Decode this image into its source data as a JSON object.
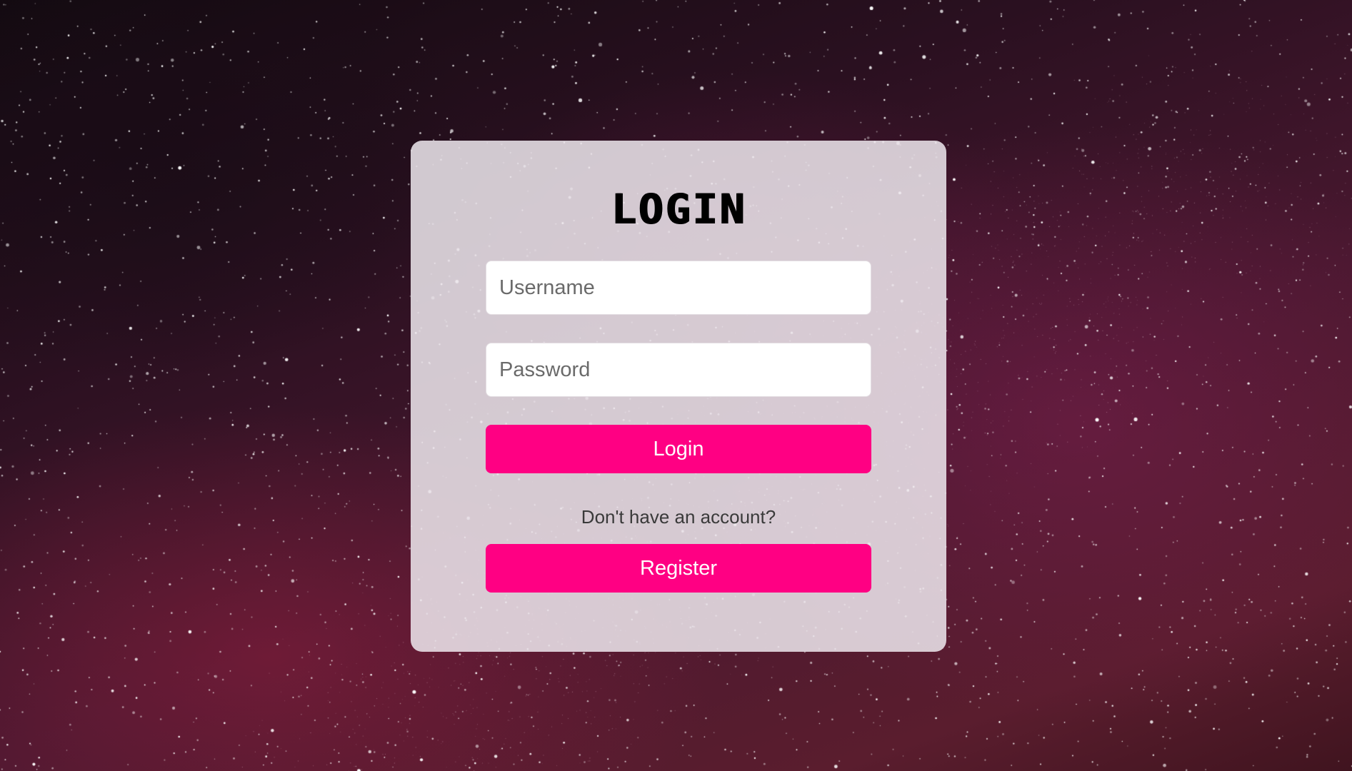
{
  "login_form": {
    "title": "LOGIN",
    "username_placeholder": "Username",
    "password_placeholder": "Password",
    "login_label": "Login",
    "register_prompt": "Don't have an account?",
    "register_label": "Register"
  },
  "colors": {
    "accent": "#ff0083",
    "card_background": "#eee8ee",
    "input_background": "#ffffff"
  }
}
